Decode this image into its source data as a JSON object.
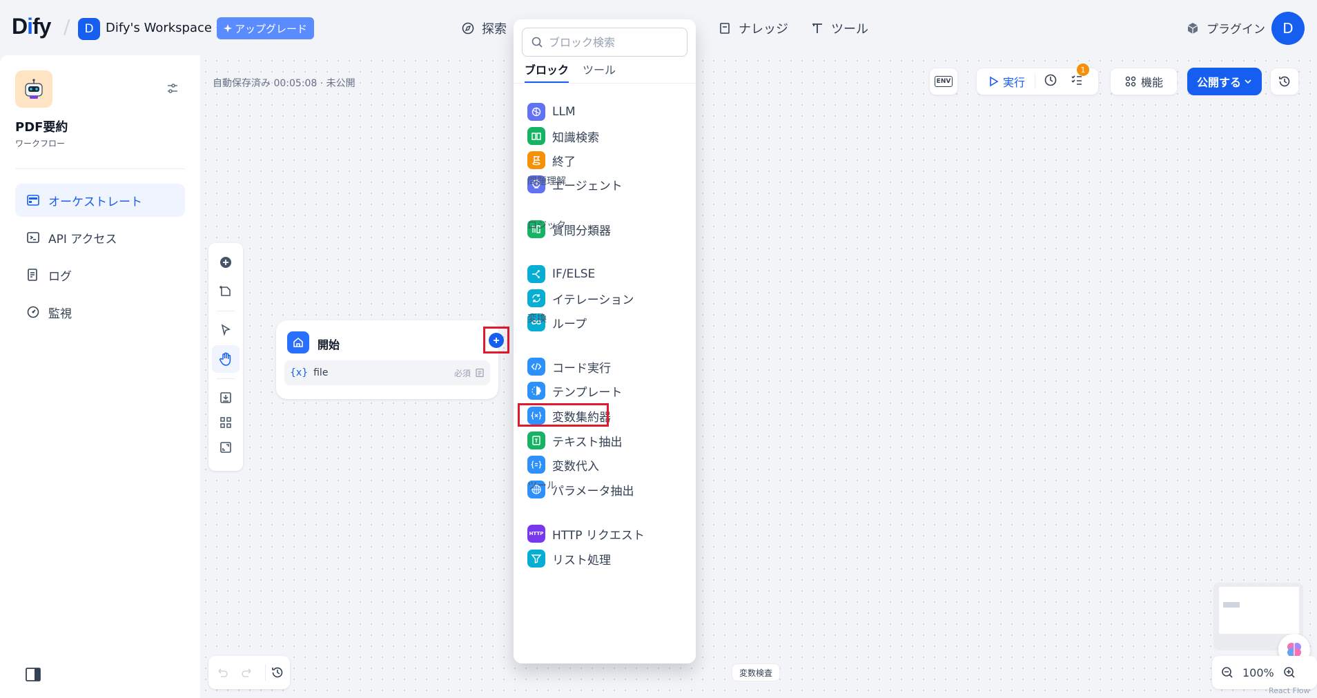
{
  "header": {
    "logo_prefix": "D",
    "logo_i": "i",
    "logo_suffix": "fy",
    "workspace_initial": "D",
    "workspace_name": "Dify's Workspace",
    "upgrade_label": "アップグレード",
    "nav": [
      {
        "label": "探索",
        "icon": "compass-icon"
      },
      {
        "label": "ナレッジ",
        "icon": "book-icon"
      },
      {
        "label": "ツール",
        "icon": "hammer-icon"
      }
    ],
    "plugin_label": "プラグイン",
    "user_initial": "D"
  },
  "app": {
    "name": "PDF要約",
    "type": "ワークフロー",
    "nav": [
      {
        "label": "オーケストレート",
        "icon": "layout-icon",
        "active": true
      },
      {
        "label": "API アクセス",
        "icon": "terminal-icon",
        "active": false
      },
      {
        "label": "ログ",
        "icon": "log-icon",
        "active": false
      },
      {
        "label": "監視",
        "icon": "gauge-icon",
        "active": false
      }
    ]
  },
  "canvas": {
    "autosave_text": "自動保存済み 00:05:08 · 未公開",
    "env_label": "ENV",
    "run_label": "実行",
    "checklist_badge": "1",
    "features_label": "機能",
    "publish_label": "公開する",
    "start_node": {
      "title": "開始",
      "var_icon": "{x}",
      "var_name": "file",
      "required_label": "必須"
    },
    "var_inspect_label": "変数検査",
    "zoom_label": "100%",
    "react_flow_label": "React Flow"
  },
  "block_picker": {
    "search_placeholder": "ブロック検索",
    "tabs": [
      "ブロック",
      "ツール"
    ],
    "items": [
      {
        "label": "LLM",
        "icon": "llm-icon",
        "color": "#6172f3"
      },
      {
        "label": "知識検索",
        "icon": "knowledge-retrieval-icon",
        "color": "#16b364"
      },
      {
        "label": "終了",
        "icon": "end-icon",
        "color": "#f79009"
      },
      {
        "label": "エージェント",
        "icon": "agent-icon",
        "color": "#6172f3"
      },
      {
        "label": "質問分類器",
        "icon": "question-classifier-icon",
        "color": "#16b364"
      },
      {
        "label": "IF/ELSE",
        "icon": "if-else-icon",
        "color": "#06aed4"
      },
      {
        "label": "イテレーション",
        "icon": "iteration-icon",
        "color": "#06aed4"
      },
      {
        "label": "ループ",
        "icon": "loop-icon",
        "color": "#06aed4"
      },
      {
        "label": "コード実行",
        "icon": "code-icon",
        "color": "#2e90fa"
      },
      {
        "label": "テンプレート",
        "icon": "template-icon",
        "color": "#2e90fa"
      },
      {
        "label": "変数集約器",
        "icon": "variable-aggregator-icon",
        "color": "#2e90fa"
      },
      {
        "label": "テキスト抽出",
        "icon": "text-extractor-icon",
        "color": "#16b364"
      },
      {
        "label": "変数代入",
        "icon": "variable-assigner-icon",
        "color": "#2e90fa"
      },
      {
        "label": "パラメータ抽出",
        "icon": "parameter-extractor-icon",
        "color": "#2e90fa"
      },
      {
        "label": "HTTP リクエスト",
        "icon": "http-icon",
        "color": "#7839ee"
      },
      {
        "label": "リスト処理",
        "icon": "list-filter-icon",
        "color": "#06aed4"
      }
    ],
    "categories": [
      "問題理解",
      "ロジック",
      "変換",
      "ツール"
    ],
    "http_badge": "HTTP"
  }
}
